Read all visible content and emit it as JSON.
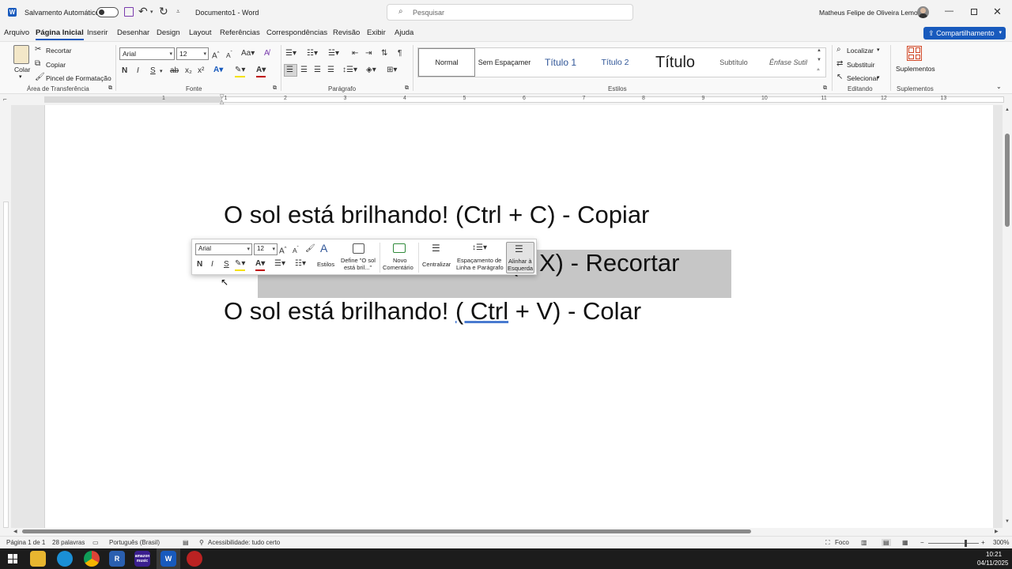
{
  "titlebar": {
    "autosave_label": "Salvamento Automático",
    "doc_title": "Documento1 - Word",
    "search_placeholder": "Pesquisar",
    "user_name": "Matheus Felipe de Oliveira Lemos"
  },
  "menu": {
    "items": [
      "Arquivo",
      "Página Inicial",
      "Inserir",
      "Desenhar",
      "Design",
      "Layout",
      "Referências",
      "Correspondências",
      "Revisão",
      "Exibir",
      "Ajuda"
    ],
    "share_label": "Compartilhamento"
  },
  "ribbon": {
    "clipboard": {
      "paste": "Colar",
      "cut": "Recortar",
      "copy": "Copiar",
      "format_painter": "Pincel de Formatação",
      "label": "Área de Transferência"
    },
    "font": {
      "name": "Arial",
      "size": "12",
      "label": "Fonte",
      "bold": "N",
      "italic": "I",
      "underline": "S"
    },
    "paragraph": {
      "label": "Parágrafo"
    },
    "styles": {
      "items": [
        "Normal",
        "Sem Espaçamer",
        "Título 1",
        "Título 2",
        "Título",
        "Subtítulo",
        "Ênfase Sutil"
      ],
      "label": "Estilos"
    },
    "editing": {
      "find": "Localizar",
      "replace": "Substituir",
      "select": "Selecionar",
      "label": "Editando"
    },
    "addins": {
      "button": "Suplementos",
      "label": "Suplementos"
    }
  },
  "ruler": {
    "numbers": [
      "1",
      "1",
      "2",
      "3",
      "4",
      "5",
      "6",
      "7",
      "8",
      "9",
      "10",
      "11",
      "12",
      "13"
    ]
  },
  "document": {
    "line1": "O sol está brilhando! (Ctrl + C) - Copiar",
    "line2_visible": "X) - Recortar",
    "line2_paren": "(",
    "line3_prefix": "O sol está brilhando! ",
    "line3_underlined": "( Ctrl",
    "line3_suffix": " + V) - Colar"
  },
  "mini_toolbar": {
    "font": "Arial",
    "size": "12",
    "bold": "N",
    "italic": "I",
    "underline": "S",
    "styles": "Estilos",
    "define_line1": "Define \"O sol",
    "define_line2": "está bril...\"",
    "new_comment_line1": "Novo",
    "new_comment_line2": "Comentário",
    "center": "Centralizar",
    "spacing_line1": "Espaçamento de",
    "spacing_line2": "Linha e Parágrafo",
    "align_left_line1": "Alinhar à",
    "align_left_line2": "Esquerda"
  },
  "statusbar": {
    "page": "Página 1 de 1",
    "words": "28 palavras",
    "language": "Português (Brasil)",
    "accessibility": "Acessibilidade: tudo certo",
    "focus": "Foco",
    "zoom": "300%"
  },
  "taskbar": {
    "time": "10:21",
    "date": "04/11/2025",
    "music_label": "amazon music"
  },
  "colors": {
    "accent": "#185abd",
    "selection": "#c6c6c6",
    "taskbar": "#1c1c1c"
  }
}
